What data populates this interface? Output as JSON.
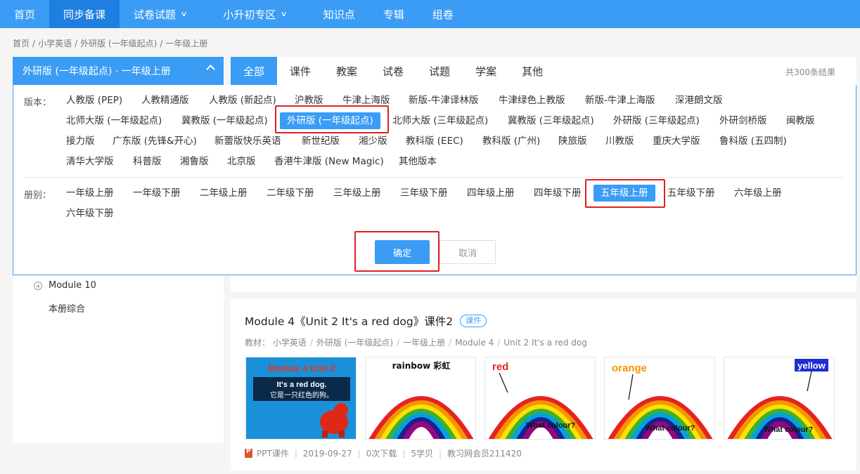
{
  "nav": {
    "items": [
      "首页",
      "同步备课",
      "试卷试题",
      "小升初专区",
      "知识点",
      "专辑",
      "组卷"
    ]
  },
  "breadcrumb": [
    "首页",
    "小学英语",
    "外研版 (一年级起点)",
    "一年级上册"
  ],
  "version_selector": {
    "label": "外研版 (一年级起点) · 一年级上册"
  },
  "tabs": [
    "全部",
    "课件",
    "教案",
    "试卷",
    "试题",
    "学案",
    "其他"
  ],
  "total_text": "共300条结果",
  "filter": {
    "edition_label": "版本：",
    "editions": [
      "人教版 (PEP)",
      "人教精通版",
      "人教版 (新起点)",
      "沪教版",
      "牛津上海版",
      "新版-牛津译林版",
      "牛津绿色上教版",
      "新版-牛津上海版",
      "深港朗文版",
      "北师大版 (一年级起点)",
      "冀教版 (一年级起点)",
      "外研版 (一年级起点)",
      "北师大版 (三年级起点)",
      "冀教版 (三年级起点)",
      "外研版 (三年级起点)",
      "外研剑桥版",
      "闽教版",
      "接力版",
      "广东版 (先锋&开心)",
      "新蕾版快乐英语",
      "新世纪版",
      "湘少版",
      "教科版 (EEC)",
      "教科版 (广州)",
      "陕旅版",
      "川教版",
      "重庆大学版",
      "鲁科版 (五四制)",
      "清华大学版",
      "科普版",
      "湘鲁版",
      "北京版",
      "香港牛津版 (New Magic)",
      "其他版本"
    ],
    "volume_label": "册别：",
    "volumes": [
      "一年级上册",
      "一年级下册",
      "二年级上册",
      "二年级下册",
      "三年级上册",
      "三年级下册",
      "四年级上册",
      "四年级下册",
      "五年级上册",
      "五年级下册",
      "六年级上册",
      "六年级下册"
    ],
    "confirm_label": "确定",
    "cancel_label": "取消"
  },
  "sidebar": {
    "items": [
      "Module 10",
      "本册综合"
    ]
  },
  "card": {
    "title": "Module 4《Unit 2 It's a red dog》课件2",
    "badge": "课件",
    "meta": [
      "教材：",
      "小学英语",
      "外研版 (一年级起点)",
      "一年级上册",
      "Module 4",
      "Unit 2 It's a red dog"
    ],
    "thumbs": [
      {
        "heading": "Module 4 Unit 2",
        "line1": "It's a red dog.",
        "line2": "它是一只红色的狗。"
      },
      {
        "heading": "rainbow 彩虹"
      },
      {
        "heading": "red",
        "caption": "What colour?"
      },
      {
        "heading": "orange",
        "caption": "What colour?"
      },
      {
        "heading": "yellow",
        "caption": "What colour?"
      }
    ],
    "footer": [
      "PPT课件",
      "2019-09-27",
      "0次下载",
      "5学贝",
      "教习网会员211420"
    ]
  },
  "colors": {
    "accent": "#3a9cf5",
    "highlight_border": "#e02020"
  }
}
